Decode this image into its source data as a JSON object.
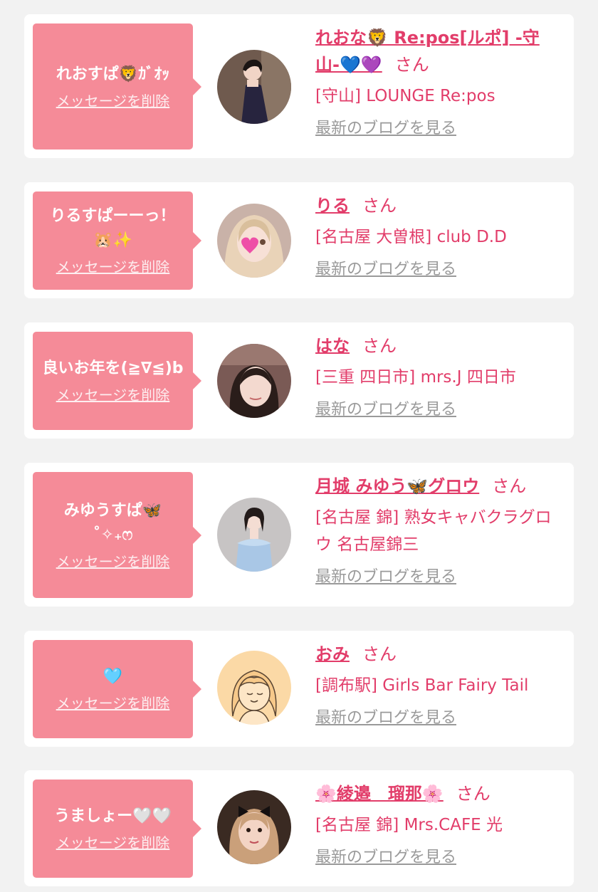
{
  "common": {
    "delete_label": "メッセージを削除",
    "blog_label": "最新のブログを見る",
    "suffix": "さん"
  },
  "colors": {
    "bubble": "#f58b98",
    "accent": "#e23d6a",
    "muted": "#9a9a9a",
    "background": "#f2f2f2"
  },
  "messages": [
    {
      "message": "れおすぱ🦁ｶﾞｵｯ",
      "name": "れおな🦁 Re:pos[ルポ] -守山-💙💜",
      "shop": "[守山] LOUNGE Re:pos",
      "avatar": "photo-woman-black-dress"
    },
    {
      "message": "りるすぱーーっ！\n🐹✨",
      "name": "りる",
      "shop": "[名古屋 大曽根] club D.D",
      "avatar": "photo-woman-heart-sticker"
    },
    {
      "message": "良いお年を(≧∇≦)b",
      "name": "はな",
      "shop": "[三重 四日市] mrs.J 四日市",
      "avatar": "photo-woman-closeup"
    },
    {
      "message": "みゆうすぱ🦋\n˚✧₊ෆ",
      "name": "月城 みゆう🦋グロウ",
      "shop": "[名古屋 錦] 熟女キャバクラグロウ 名古屋錦三",
      "avatar": "photo-woman-blue-dress"
    },
    {
      "message": "🩵",
      "name": "おみ",
      "shop": "[調布駅] Girls Bar Fairy Tail",
      "avatar": "illustration-smiling-girl"
    },
    {
      "message": "うましょー🤍🤍",
      "name": "🌸綾邉　瑠那🌸",
      "shop": "[名古屋 錦] Mrs.CAFE 光",
      "avatar": "photo-woman-bow"
    }
  ]
}
